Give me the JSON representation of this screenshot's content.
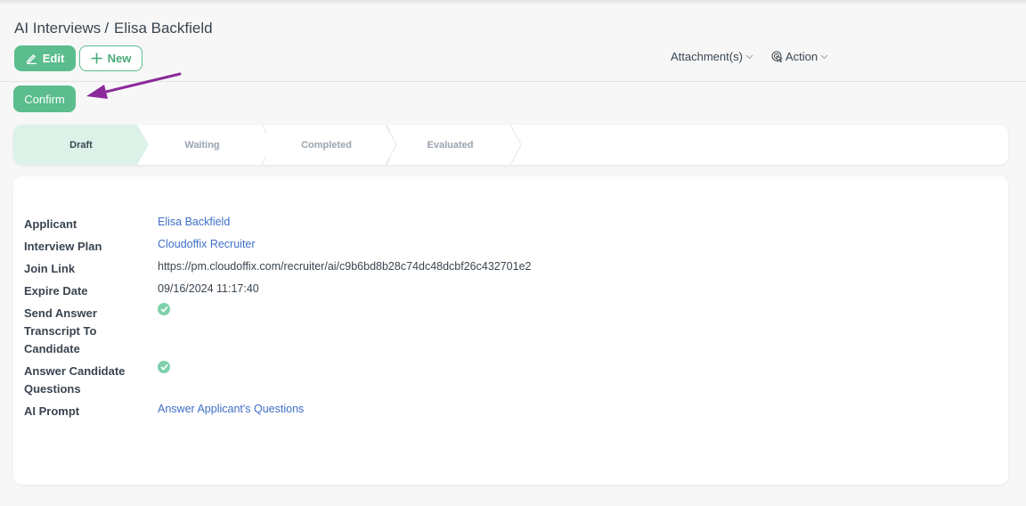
{
  "breadcrumb": {
    "parent": "AI Interviews",
    "separator": "/",
    "current": "Elisa Backfield"
  },
  "toolbar": {
    "edit_label": "Edit",
    "new_label": "New",
    "confirm_label": "Confirm",
    "attachments_label": "Attachment(s)",
    "action_label": "Action"
  },
  "stages": [
    {
      "label": "Draft",
      "active": true
    },
    {
      "label": "Waiting",
      "active": false
    },
    {
      "label": "Completed",
      "active": false
    },
    {
      "label": "Evaluated",
      "active": false
    }
  ],
  "fields": {
    "applicant": {
      "label": "Applicant",
      "value": "Elisa Backfield"
    },
    "interview_plan": {
      "label": "Interview Plan",
      "value": "Cloudoffix Recruiter"
    },
    "join_link": {
      "label": "Join Link",
      "value": "https://pm.cloudoffix.com/recruiter/ai/c9b6bd8b28c74dc48dcbf26c432701e2"
    },
    "expire_date": {
      "label": "Expire Date",
      "value": "09/16/2024 11:17:40"
    },
    "send_transcript": {
      "label_lines": [
        "Send Answer",
        "Transcript To",
        "Candidate"
      ],
      "checked": true
    },
    "answer_questions": {
      "label_lines": [
        "Answer Candidate",
        "Questions"
      ],
      "checked": true
    },
    "ai_prompt": {
      "label": "AI Prompt",
      "value": "Answer Applicant's Questions"
    }
  },
  "colors": {
    "primary": "#5bbd8d",
    "active_stage": "#dcf1e8",
    "link": "#3f6fc7",
    "annotation_arrow": "#8b2a9a"
  }
}
